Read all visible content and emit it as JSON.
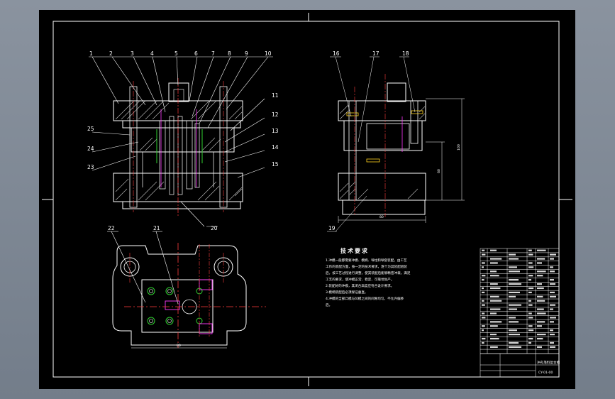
{
  "drawing": {
    "part_labels_front": [
      "1",
      "2",
      "3",
      "4",
      "5",
      "6",
      "7",
      "8",
      "9",
      "10"
    ],
    "part_labels_right_front": [
      "11",
      "12",
      "13",
      "14",
      "15"
    ],
    "part_labels_left_front": [
      "25",
      "24",
      "23"
    ],
    "part_labels_bottom_front": [
      "20"
    ],
    "part_labels_side": [
      "16",
      "17",
      "18",
      "19"
    ],
    "part_labels_top": [
      "22",
      "21"
    ],
    "tech_title": "技术要求",
    "tech_notes": [
      "1.冲模一般都需要冲模、模柄、导柱和导套装配，由工艺",
      "工作的装配方面，按一定的技术要求，逐个为其装配组装",
      "后，按工艺过程进行调整，使其装配后能够精密冲裁，满足",
      "工艺的要求，使冲模正常、稳定、可靠地生产。",
      "2.装配好的冲模，其闭合高度应符合设计要求。",
      "3.模柄装配后必须保证垂直。",
      "4.冲模的全部凸模与凹模之间的间隙均匀，不允许偏移",
      "后。"
    ],
    "dimension_text": "80",
    "title_block_name": "冲孔落料复合模",
    "title_block_code": "CY-01-00"
  }
}
